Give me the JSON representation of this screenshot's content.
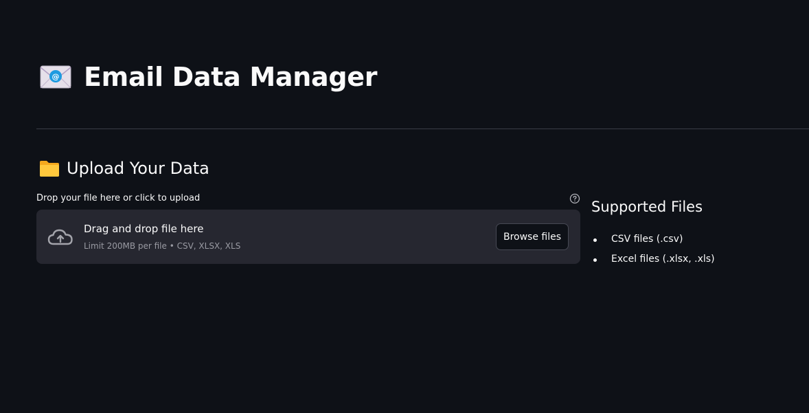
{
  "header": {
    "title": "Email Data Manager"
  },
  "upload_section": {
    "title": "Upload Your Data",
    "label": "Drop your file here or click to upload",
    "dropzone": {
      "title": "Drag and drop file here",
      "limit": "Limit 200MB per file • CSV, XLSX, XLS",
      "browse_label": "Browse files"
    }
  },
  "supported_files": {
    "title": "Supported Files",
    "items": [
      {
        "label": "CSV files (.csv)"
      },
      {
        "label": "Excel files (.xlsx, .xls)"
      }
    ]
  },
  "icons": {
    "title_icon": "envelope-icon",
    "section_icon": "folder-icon",
    "help_icon": "question-circle-icon",
    "upload_icon": "cloud-upload-icon"
  },
  "colors": {
    "background": "#0e1117",
    "dropzone": "#262730",
    "text": "#fafafa",
    "muted_text": "#9a9ba3",
    "divider": "#3a3d47"
  }
}
